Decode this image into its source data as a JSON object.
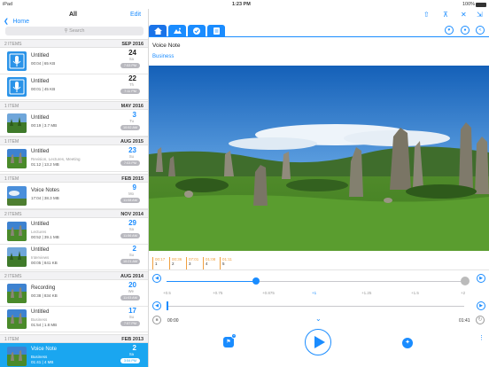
{
  "status": {
    "device": "iPad",
    "time": "1:23 PM",
    "battery": "100%"
  },
  "left": {
    "back_label": "Home",
    "title": "All",
    "edit_label": "Edit",
    "search_placeholder": "Search",
    "sections": [
      {
        "count": "2 ITEMS",
        "month": "SEP 2016"
      },
      {
        "count": "1 ITEM",
        "month": "MAY 2016"
      },
      {
        "count": "1 ITEM",
        "month": "AUG 2015"
      },
      {
        "count": "1 ITEM",
        "month": "FEB 2015"
      },
      {
        "count": "2 ITEMS",
        "month": "NOV 2014"
      },
      {
        "count": "2 ITEMS",
        "month": "AUG 2014"
      },
      {
        "count": "1 ITEM",
        "month": "FEB 2013"
      }
    ],
    "rows": [
      {
        "title": "Untitled",
        "sub": "",
        "meta": "00:04 | 65 KB",
        "day": "24",
        "weekday": "Sa",
        "time": "7:53 PM",
        "thumb": "mic"
      },
      {
        "title": "Untitled",
        "sub": "",
        "meta": "00:01 | 45 KB",
        "day": "22",
        "weekday": "Th",
        "time": "7:11 PM",
        "thumb": "mic"
      },
      {
        "title": "Untitled",
        "sub": "",
        "meta": "00:19 | 3.7 MB",
        "day": "3",
        "weekday": "Tu",
        "time": "10:52 AM",
        "thumb": "forest"
      },
      {
        "title": "Untitled",
        "sub": "Revision, Lectures, Meeting",
        "meta": "01:12 | 13.2 MB",
        "day": "23",
        "weekday": "Su",
        "time": "7:03 PM",
        "thumb": "rocks"
      },
      {
        "title": "Voice Notes",
        "sub": "",
        "meta": "17:04 | 38.3 MB",
        "day": "9",
        "weekday": "Mo",
        "time": "11:08 AM",
        "thumb": "sky"
      },
      {
        "title": "Untitled",
        "sub": "Lectures",
        "meta": "00:52 | 39.1 MB",
        "day": "29",
        "weekday": "Sa",
        "time": "11:56 AM",
        "thumb": "rocks"
      },
      {
        "title": "Untitled",
        "sub": "Interviews",
        "meta": "00:05 | 841 KB",
        "day": "2",
        "weekday": "Su",
        "time": "10:21 AM",
        "thumb": "forest"
      },
      {
        "title": "Recording",
        "sub": "",
        "meta": "00:38 | 834 KB",
        "day": "20",
        "weekday": "We",
        "time": "11:03 AM",
        "thumb": "rocks"
      },
      {
        "title": "Untitled",
        "sub": "Business",
        "meta": "01:54 | 1.8 MB",
        "day": "17",
        "weekday": "Su",
        "time": "7:57 PM",
        "thumb": "rocks"
      },
      {
        "title": "Voice Note",
        "sub": "Business",
        "meta": "01:41 | 4 MB",
        "day": "2",
        "weekday": "Sa",
        "time": "3:54 PM",
        "thumb": "rocks"
      }
    ]
  },
  "right": {
    "note_title": "Voice Note",
    "note_tag": "Business",
    "markers": [
      {
        "time": "00:17",
        "num": "1"
      },
      {
        "time": "00:36",
        "num": "2"
      },
      {
        "time": "07:01",
        "num": "3"
      },
      {
        "time": "01:08",
        "num": "4"
      },
      {
        "time": "01:11",
        "num": "5"
      }
    ],
    "speeds": [
      "+0.5",
      "+0.75",
      "+0.875",
      "+1",
      "+1.25",
      "+1.5",
      "+2"
    ],
    "current_speed": "+1",
    "speed_fraction": 0.3,
    "time_start": "00:00",
    "time_end": "01:41",
    "progress_fraction": 0.0,
    "accent": "#1a8cff"
  }
}
